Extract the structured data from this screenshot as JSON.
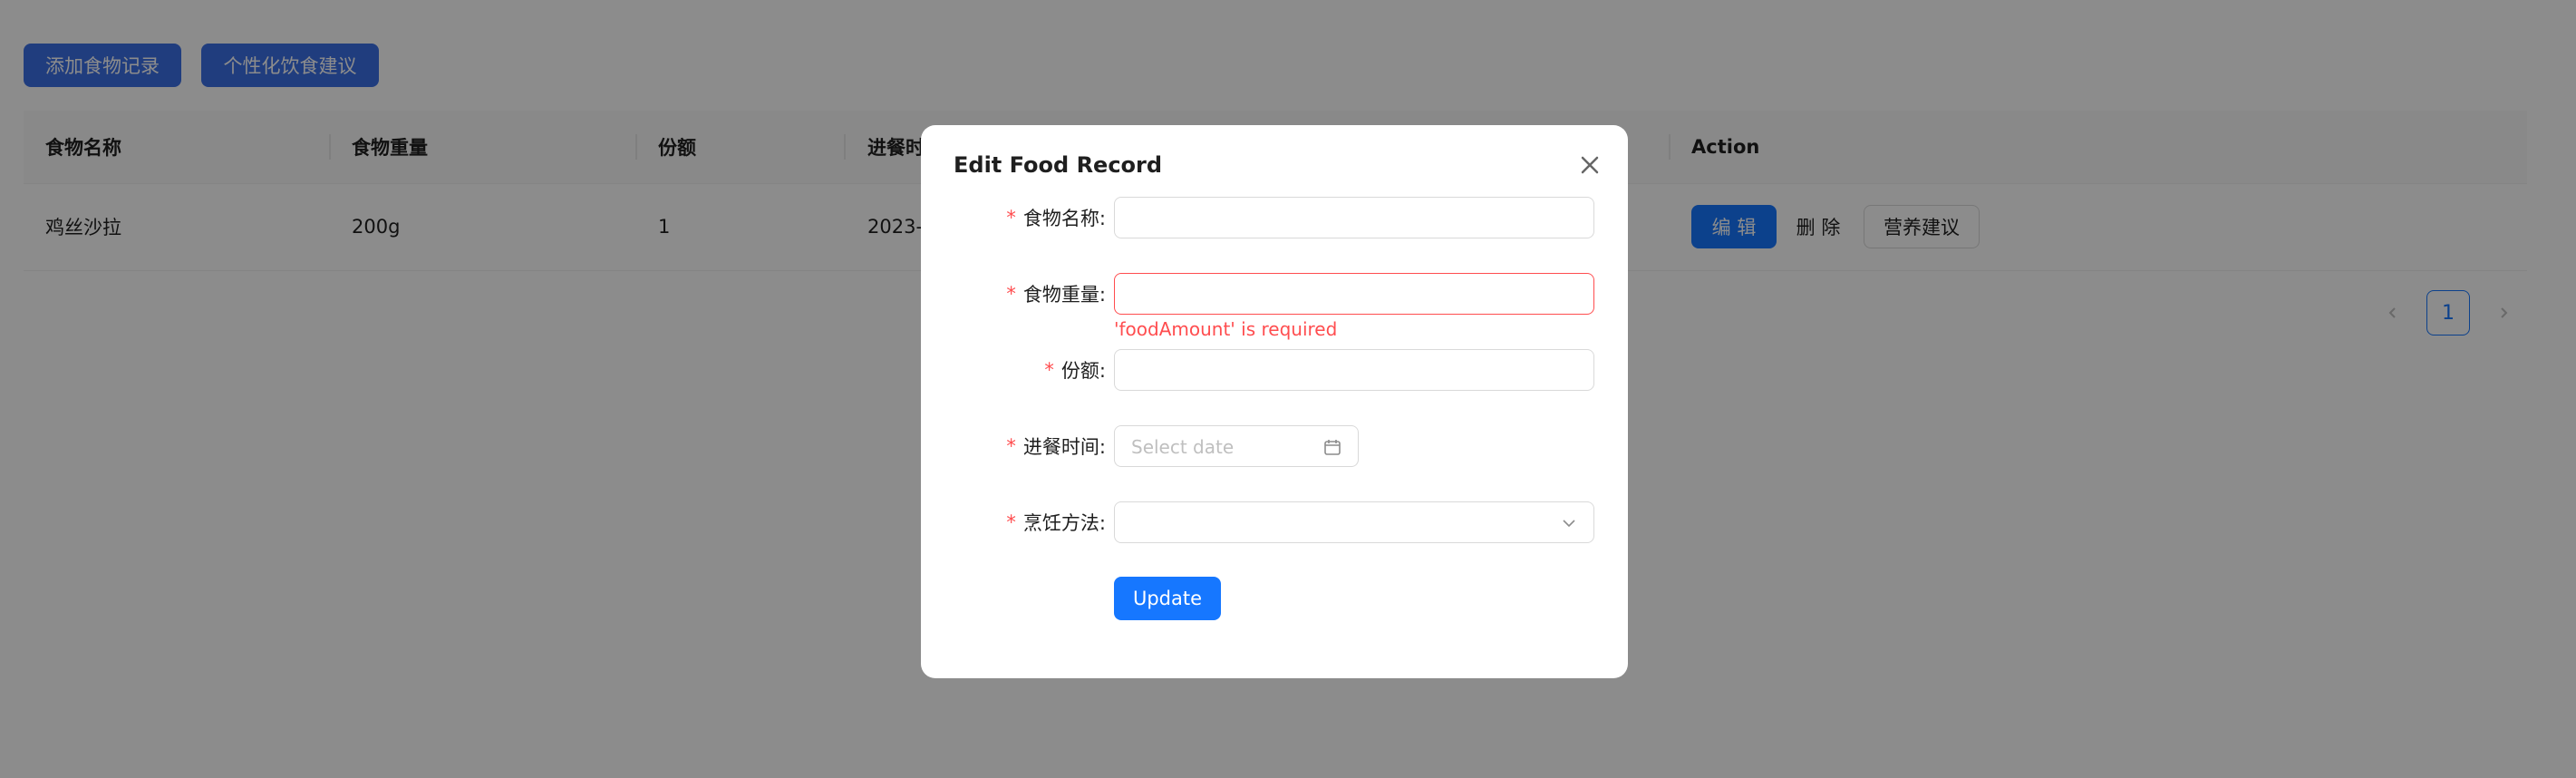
{
  "toolbar": {
    "add_label": "添加食物记录",
    "advice_label": "个性化饮食建议"
  },
  "table": {
    "columns": [
      "食物名称",
      "食物重量",
      "份额",
      "进餐时",
      "Action"
    ],
    "rows": [
      {
        "name": "鸡丝沙拉",
        "weight": "200g",
        "portion": "1",
        "time": "2023-"
      }
    ],
    "actions": {
      "edit": "编 辑",
      "delete": "删 除",
      "nutrition": "营养建议"
    }
  },
  "pagination": {
    "current": "1",
    "prev_icon": "chevron-left-icon",
    "next_icon": "chevron-right-icon"
  },
  "modal": {
    "title": "Edit Food Record",
    "fields": {
      "food_name": {
        "label": "食物名称:",
        "value": ""
      },
      "food_amount": {
        "label": "食物重量:",
        "value": "",
        "error": "'foodAmount' is required"
      },
      "portion": {
        "label": "份额:",
        "value": ""
      },
      "meal_time": {
        "label": "进餐时间:",
        "placeholder": "Select date"
      },
      "cooking_method": {
        "label": "烹饪方法:",
        "value": ""
      }
    },
    "submit_label": "Update"
  },
  "colors": {
    "primary": "#1677ff",
    "error": "#ff4d4f"
  }
}
